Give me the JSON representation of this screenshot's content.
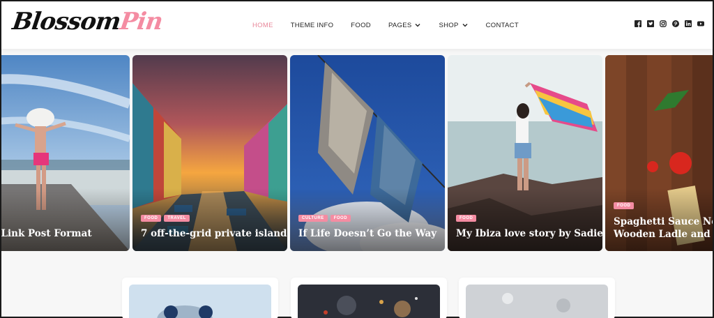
{
  "brand": {
    "part1": "Blossom",
    "part2": "Pin"
  },
  "nav": {
    "home": "HOME",
    "theme_info": "THEME INFO",
    "food": "FOOD",
    "pages": "PAGES",
    "shop": "SHOP",
    "contact": "CONTACT"
  },
  "social": [
    "facebook-icon",
    "twitter-icon",
    "instagram-icon",
    "pinterest-icon",
    "linkedin-icon",
    "youtube-icon"
  ],
  "slides": [
    {
      "title": "rnal Link Post Format",
      "tags": []
    },
    {
      "title": "7 off-the-grid private island",
      "tags": [
        "FOOD",
        "TRAVEL"
      ]
    },
    {
      "title": "If Life Doesn’t Go the Way",
      "tags": [
        "CULTURE",
        "FOOD"
      ]
    },
    {
      "title": "My Ibiza love story by Sadie Frost",
      "tags": [
        "FOOD"
      ]
    },
    {
      "title_line1": "Spaghetti Sauce Near Bro",
      "title_line2": "Wooden Ladle and Ripe T",
      "tags": [
        "FOOD"
      ]
    }
  ],
  "colors": {
    "accent": "#f48ca2",
    "nav_active": "#e8879a",
    "text": "#222222"
  }
}
